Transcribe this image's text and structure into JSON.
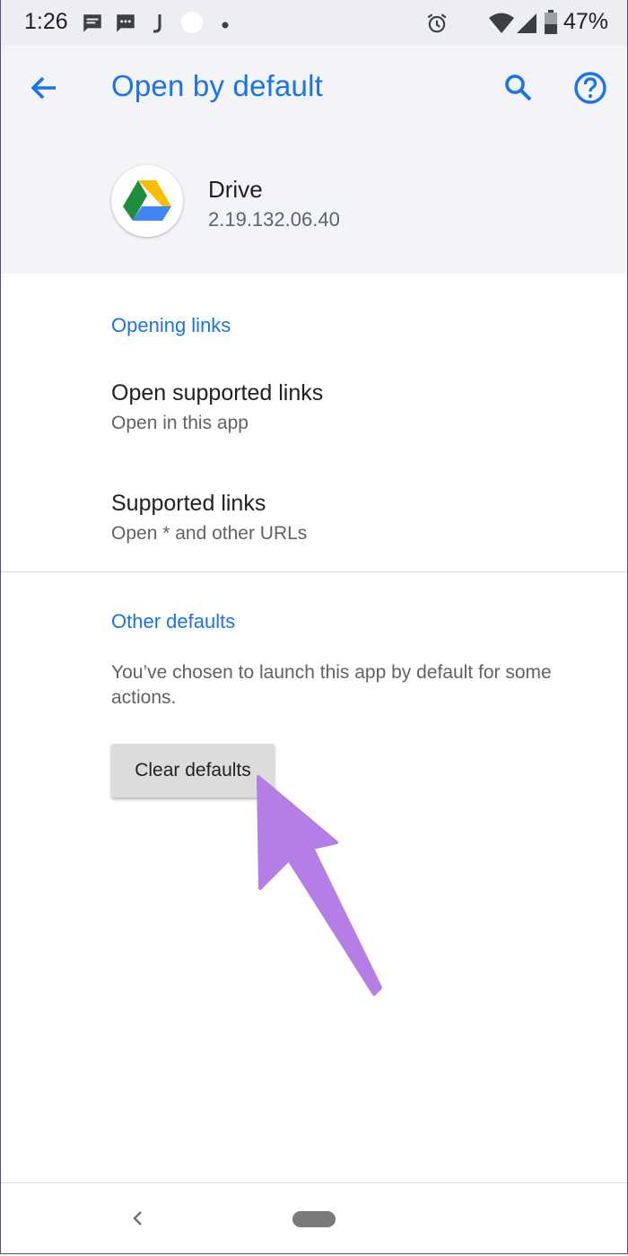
{
  "status_bar": {
    "time": "1:26",
    "battery_percent": "47%",
    "battery_level": 0.47,
    "icons": [
      "message-icon",
      "chat-icon",
      "j-icon",
      "circle-icon",
      "dot-icon",
      "alarm-icon",
      "wifi-icon",
      "signal-icon",
      "battery-icon"
    ]
  },
  "header": {
    "title": "Open by default",
    "back_icon": "arrow-back-icon",
    "search_icon": "search-icon",
    "help_icon": "help-icon"
  },
  "app": {
    "name": "Drive",
    "version": "2.19.132.06.40",
    "icon": "google-drive-icon"
  },
  "opening_links": {
    "title": "Opening links",
    "items": [
      {
        "title": "Open supported links",
        "summary": "Open in this app"
      },
      {
        "title": "Supported links",
        "summary": "Open * and other URLs"
      }
    ]
  },
  "other_defaults": {
    "title": "Other defaults",
    "description": "You’ve chosen to launch this app by default for some actions.",
    "button_label": "Clear defaults"
  },
  "annotation": {
    "arrow_color": "#b57ee6"
  },
  "colors": {
    "accent": "#1a73e8",
    "header_bg": "#f3f4f8",
    "status_bg": "#eceef2"
  },
  "nav_bar": {
    "back_icon": "nav-back-icon",
    "home_icon": "home-pill-icon"
  }
}
